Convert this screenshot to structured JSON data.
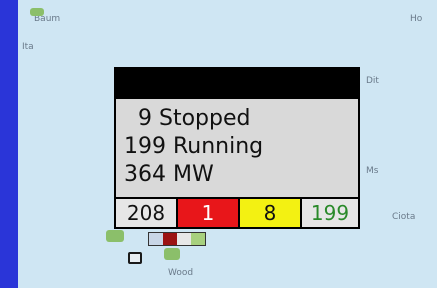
{
  "map": {
    "labels": [
      "Baum",
      "Ho",
      "Ita",
      "Dit",
      "Ms",
      "Ciota",
      "Wood"
    ]
  },
  "popup": {
    "stopped": "  9 Stopped",
    "running": "199 Running",
    "mw": "364 MW",
    "counts": [
      {
        "value": "208",
        "color": "#e6e6e6",
        "text_color": "#111111"
      },
      {
        "value": "1",
        "color": "#e8161a",
        "text_color": "#ffffff"
      },
      {
        "value": "8",
        "color": "#f3f112",
        "text_color": "#111111"
      },
      {
        "value": "199",
        "color": "#e6e6e6",
        "text_color": "#2a8a2a"
      }
    ]
  },
  "colors": {
    "frame": "#2a35d8",
    "water": "#cfe6f3",
    "land": "#8bbf6a"
  }
}
